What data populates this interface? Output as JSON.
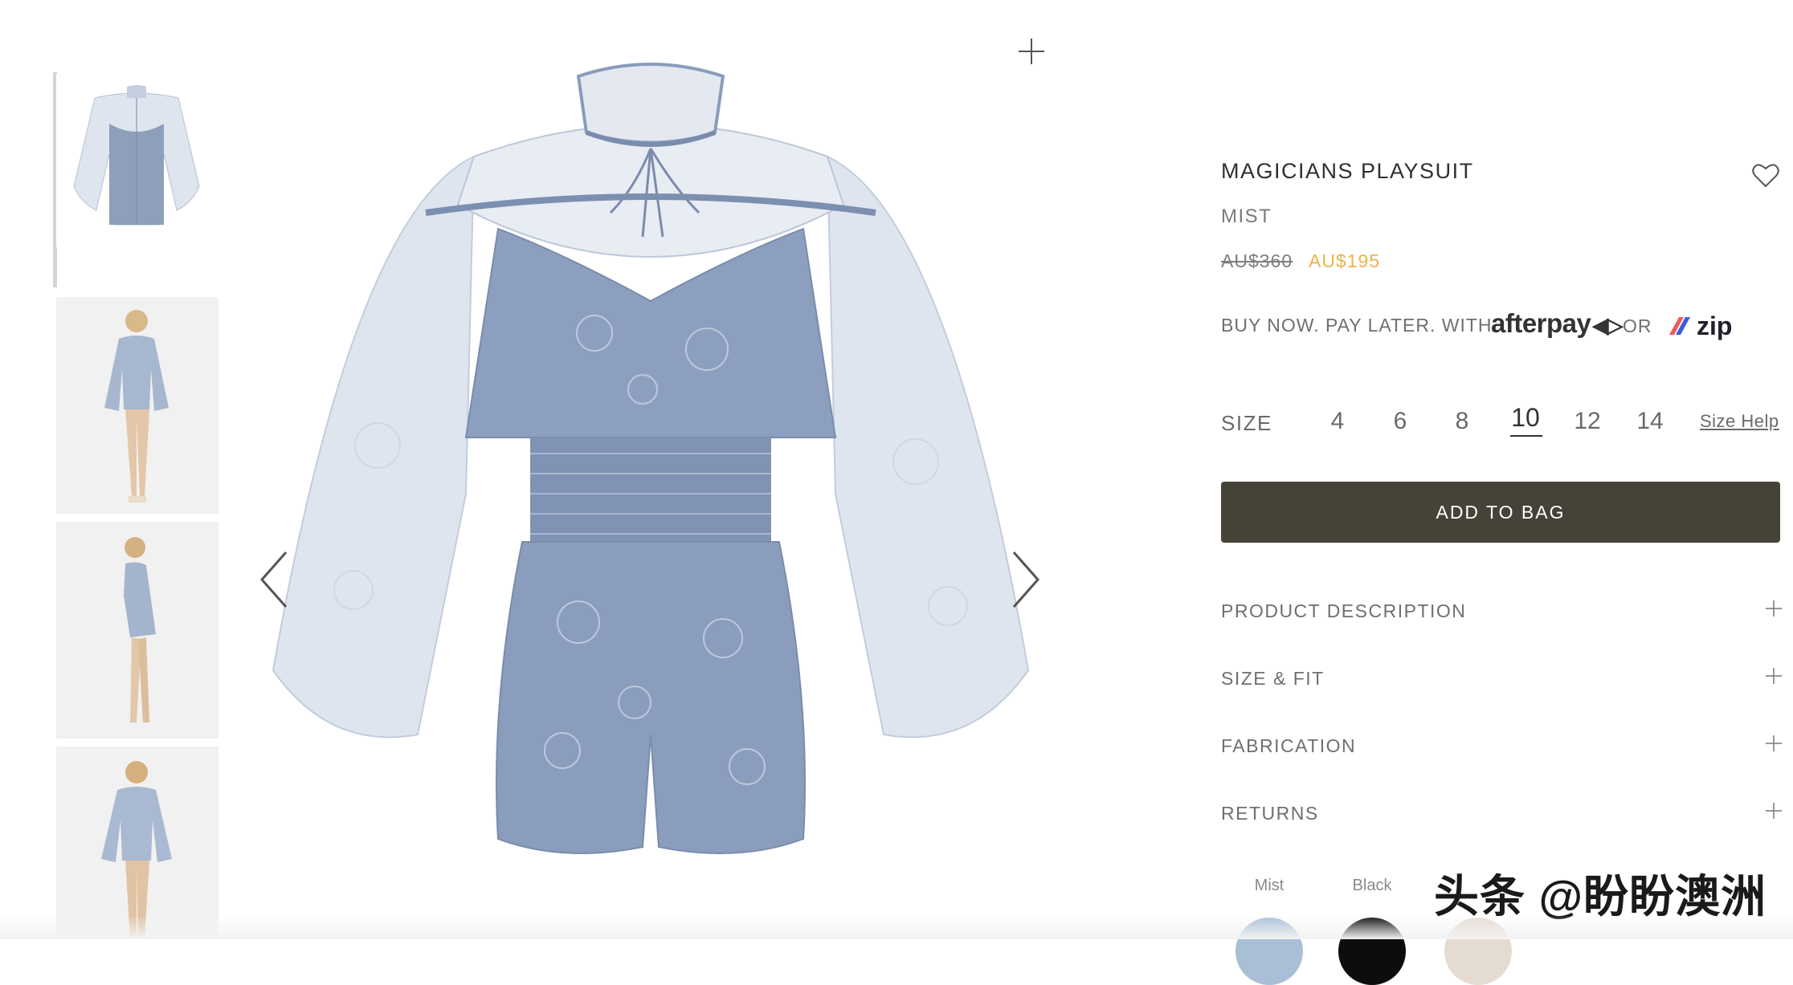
{
  "product": {
    "title": "MAGICIANS PLAYSUIT",
    "color": "MIST",
    "price_original": "AU$360",
    "price_sale": "AU$195",
    "sale_color": "#ebb34a"
  },
  "payment": {
    "prefix": "BUY NOW. PAY LATER. WITH",
    "afterpay": "afterpay",
    "or": "OR",
    "zip": "zip"
  },
  "size": {
    "label": "SIZE",
    "options": [
      "4",
      "6",
      "8",
      "10",
      "12",
      "14"
    ],
    "selected": "10",
    "help": "Size Help"
  },
  "add_to_bag": "ADD TO BAG",
  "accordion": [
    {
      "label": "PRODUCT DESCRIPTION",
      "icon": "plus-icon"
    },
    {
      "label": "SIZE & FIT",
      "icon": "plus-icon"
    },
    {
      "label": "FABRICATION",
      "icon": "plus-icon"
    },
    {
      "label": "RETURNS",
      "icon": "plus-icon"
    }
  ],
  "swatches": [
    {
      "label": "Mist",
      "color": "#a9bfd6"
    },
    {
      "label": "Black",
      "color": "#0d0d0d"
    },
    {
      "label": "",
      "color": "#e5dcd1"
    }
  ],
  "watermark": "头条 @盼盼澳洲",
  "colors": {
    "button": "#454338",
    "garment": "#8a9cbc",
    "lace": "#c7d1e2"
  },
  "icons": [
    "zoom-plus-icon",
    "heart-icon",
    "chevron-left-icon",
    "chevron-right-icon",
    "plus-icon"
  ]
}
